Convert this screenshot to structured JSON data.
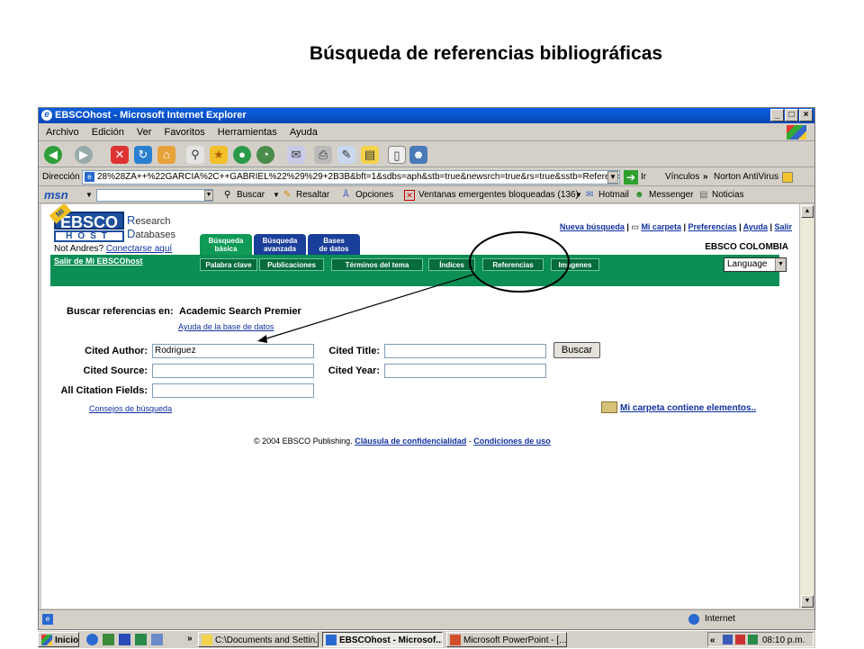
{
  "slide_title": "Búsqueda de referencias bibliográficas",
  "window": {
    "title": "EBSCOhost - Microsoft Internet Explorer"
  },
  "menu": [
    "Archivo",
    "Edición",
    "Ver",
    "Favoritos",
    "Herramientas",
    "Ayuda"
  ],
  "address": {
    "label": "Dirección",
    "url": "28%28ZA++%22GARCIA%2C++GABRIEL%22%29%29+2B3B&bft=1&sdbs=aph&stb=true&newsrch=true&rs=true&sstb=References",
    "go": "Ir",
    "links": "Vínculos",
    "norton": "Norton AntiVirus"
  },
  "msnbar": {
    "logo": "msn",
    "buscar": "Buscar",
    "resaltar": "Resaltar",
    "opciones": "Opciones",
    "popups": "Ventanas emergentes bloqueadas (136)",
    "hotmail": "Hotmail",
    "messenger": "Messenger",
    "noticias": "Noticias"
  },
  "ebsco": {
    "logo_top": "EBSCO",
    "logo_bottom": "HOST",
    "logo_badge": "MI",
    "research": "esearch",
    "databases": "atabases",
    "not_user": "Not Andres?",
    "connect": "Conectarse aquí",
    "logout": "Salir de Mi EBSCOhost",
    "tabs": [
      {
        "line1": "Búsqueda",
        "line2": "básica"
      },
      {
        "line1": "Búsqueda",
        "line2": "avanzada"
      },
      {
        "line1": "Bases",
        "line2": "de datos"
      }
    ],
    "topnav": [
      "Nueva búsqueda",
      "Mi carpeta",
      "Preferencias",
      "Ayuda",
      "Salir"
    ],
    "org": "EBSCO COLOMBIA",
    "subtabs": [
      "Palabra clave",
      "Publicaciones",
      "Términos del tema",
      "Índices",
      "Referencias",
      "Imágenes"
    ],
    "language": "Language"
  },
  "search": {
    "heading": "Buscar referencias en:",
    "database": "Academic Search Premier",
    "db_help": "Ayuda de la base de datos",
    "cited_author_label": "Cited Author:",
    "cited_author_value": "Rodriguez",
    "cited_title_label": "Cited Title:",
    "cited_source_label": "Cited Source:",
    "cited_year_label": "Cited Year:",
    "all_fields_label": "All Citation Fields:",
    "button": "Buscar",
    "tips": "Consejos de búsqueda",
    "folder": "Mi carpeta contiene elementos.."
  },
  "footer": {
    "copyright": "© 2004 EBSCO Publishing.",
    "privacy": "Cláusula de confidencialidad",
    "sep": "-",
    "terms": "Condiciones de uso"
  },
  "status": {
    "zone": "Internet"
  },
  "taskbar": {
    "start": "Inicio",
    "tasks": [
      "C:\\Documents and Settin...",
      "EBSCOhost - Microsof...",
      "Microsoft PowerPoint - [..."
    ],
    "time": "08:10 p.m."
  }
}
